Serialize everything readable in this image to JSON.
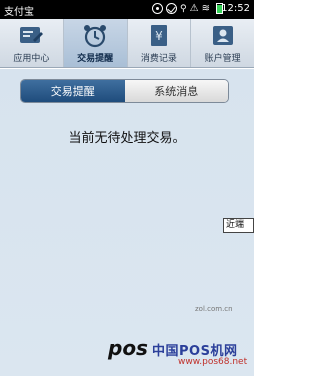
{
  "status_bar": {
    "app_name": "支付宝",
    "time": "12:52"
  },
  "tabs": [
    {
      "label": "应用中心",
      "icon": "edit-icon",
      "active": false
    },
    {
      "label": "交易提醒",
      "icon": "alarm-clock-icon",
      "active": true
    },
    {
      "label": "消费记录",
      "icon": "receipt-icon",
      "active": false
    },
    {
      "label": "账户管理",
      "icon": "user-card-icon",
      "active": false
    }
  ],
  "segments": [
    {
      "label": "交易提醒",
      "active": true
    },
    {
      "label": "系统消息",
      "active": false
    }
  ],
  "main": {
    "empty_message": "当前无待处理交易。"
  },
  "tooltip": "近端",
  "watermark": {
    "logo": "pos",
    "cn_text": "中国POS机网",
    "url": "www.pos68.net",
    "corner": "zol.com.cn"
  },
  "colors": {
    "active_segment": "#2a5a8a",
    "tab_active": "#b6c9de",
    "content_bg": "#d9e4ef"
  }
}
